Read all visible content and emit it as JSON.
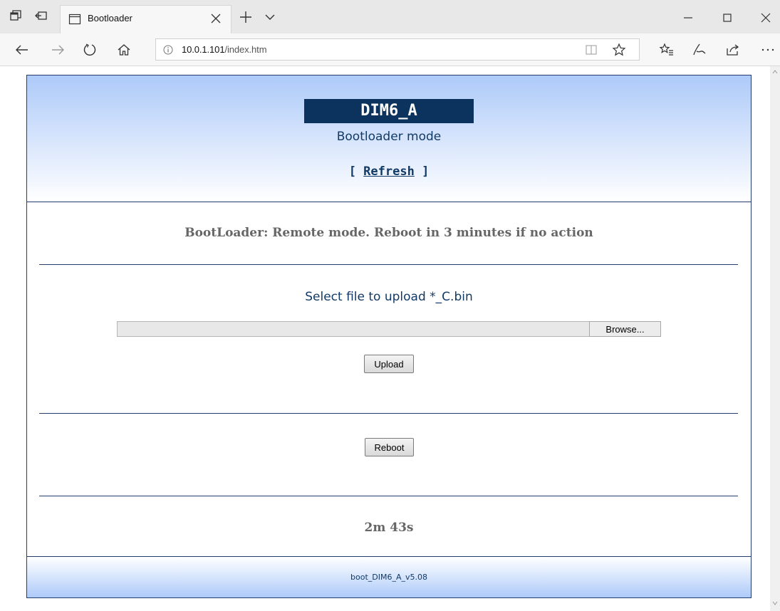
{
  "browser": {
    "tab_title": "Bootloader",
    "url_host": "10.0.1.101",
    "url_path": "/index.htm"
  },
  "page": {
    "device_name": "DIM6_A",
    "mode_text": "Bootloader mode",
    "refresh_open": "[ ",
    "refresh_label": "Refresh",
    "refresh_close": " ]",
    "status_text": "BootLoader: Remote mode. Reboot in 3 minutes if no action",
    "upload_label": "Select file to upload *_C.bin",
    "file_value": "",
    "browse_label": "Browse...",
    "upload_button": "Upload",
    "reboot_button": "Reboot",
    "timer_text": "2m 43s",
    "footer_text": "boot_DIM6_A_v5.08"
  },
  "colors": {
    "header_gradient_top": "#adcaf9",
    "device_name_bg": "#0b335e",
    "text_blue": "#123a66",
    "text_gray": "#666666",
    "border": "#233d6d"
  }
}
